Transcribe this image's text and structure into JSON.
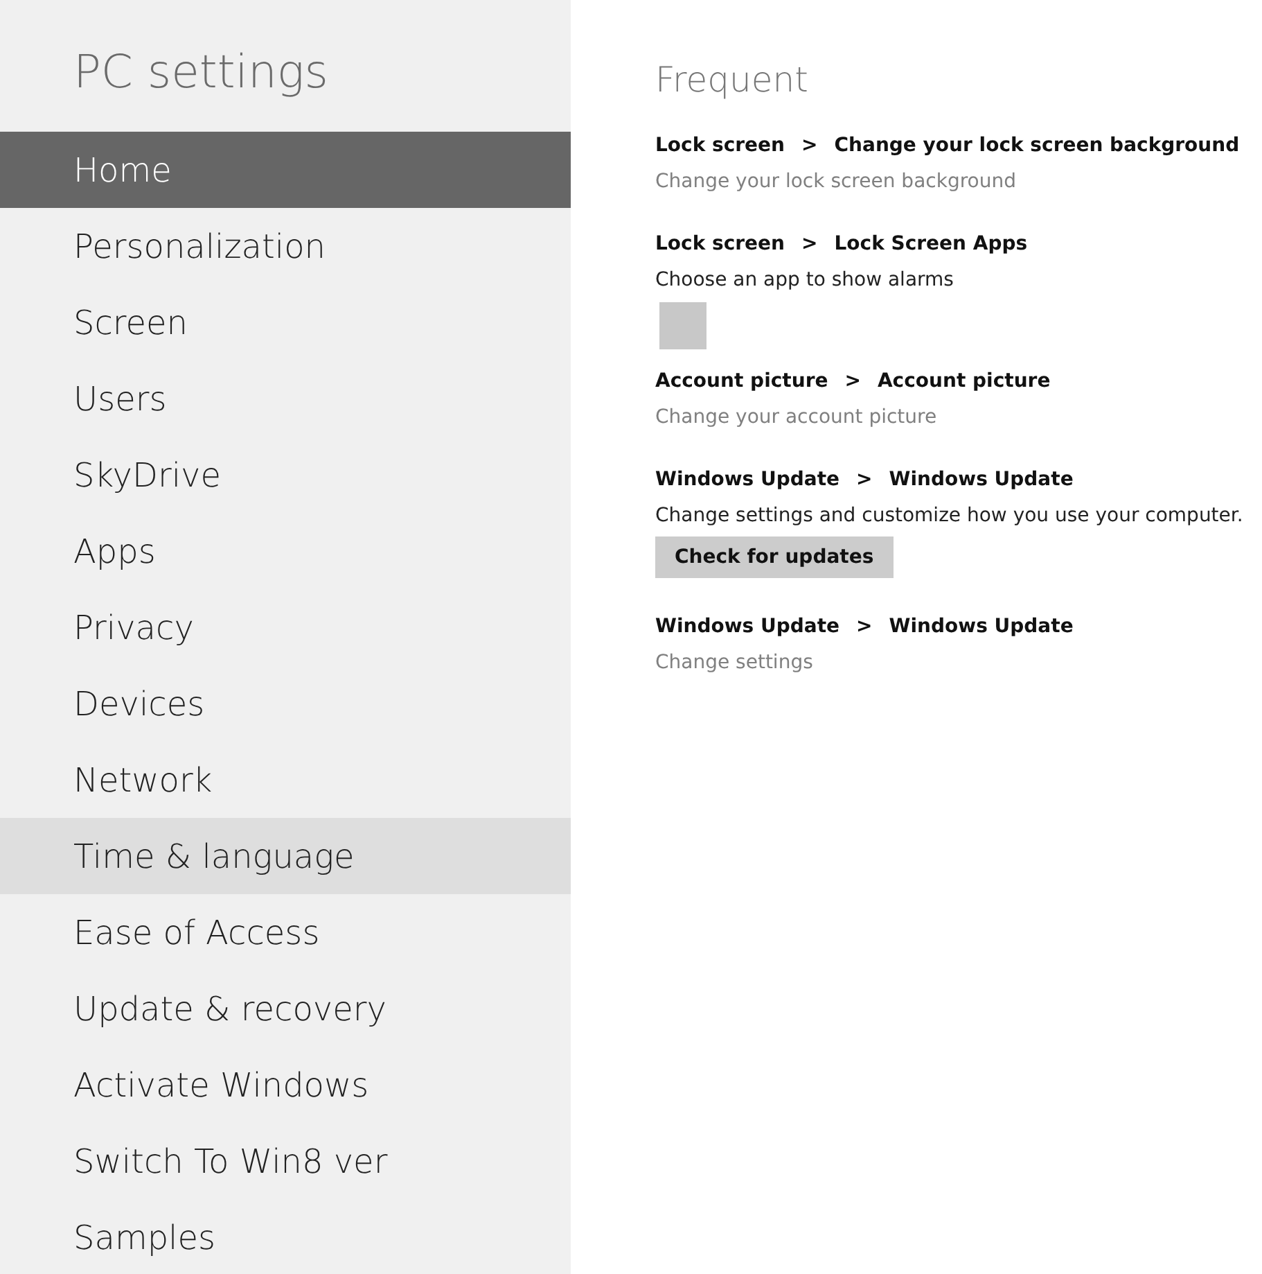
{
  "sidebar": {
    "title": "PC settings",
    "items": [
      {
        "label": "Home",
        "selected": true,
        "hovered": false
      },
      {
        "label": "Personalization",
        "selected": false,
        "hovered": false
      },
      {
        "label": "Screen",
        "selected": false,
        "hovered": false
      },
      {
        "label": "Users",
        "selected": false,
        "hovered": false
      },
      {
        "label": "SkyDrive",
        "selected": false,
        "hovered": false
      },
      {
        "label": "Apps",
        "selected": false,
        "hovered": false
      },
      {
        "label": "Privacy",
        "selected": false,
        "hovered": false
      },
      {
        "label": "Devices",
        "selected": false,
        "hovered": false
      },
      {
        "label": "Network",
        "selected": false,
        "hovered": false
      },
      {
        "label": "Time & language",
        "selected": false,
        "hovered": true
      },
      {
        "label": "Ease of Access",
        "selected": false,
        "hovered": false
      },
      {
        "label": "Update & recovery",
        "selected": false,
        "hovered": false
      },
      {
        "label": "Activate Windows",
        "selected": false,
        "hovered": false
      },
      {
        "label": "Switch To Win8 ver",
        "selected": false,
        "hovered": false
      },
      {
        "label": "Samples",
        "selected": false,
        "hovered": false
      }
    ]
  },
  "main": {
    "heading": "Frequent",
    "entries": [
      {
        "category": "Lock screen",
        "separator": ">",
        "page": "Change your lock screen background",
        "description": "Change your lock screen background",
        "dimmed": true
      },
      {
        "category": "Lock screen",
        "separator": ">",
        "page": "Lock Screen Apps",
        "description": "Choose an app to show alarms",
        "dimmed": false,
        "extra": {
          "kind": "tile"
        }
      },
      {
        "category": "Account picture",
        "separator": ">",
        "page": "Account picture",
        "description": "Change your account picture",
        "dimmed": true
      },
      {
        "category": "Windows Update",
        "separator": ">",
        "page": "Windows Update",
        "description": "Change settings and customize how you use your computer.",
        "dimmed": false,
        "extra": {
          "kind": "button",
          "label": "Check for updates"
        }
      },
      {
        "category": "Windows Update",
        "separator": ">",
        "page": "Windows Update",
        "description": "Change settings",
        "dimmed": true
      }
    ]
  }
}
